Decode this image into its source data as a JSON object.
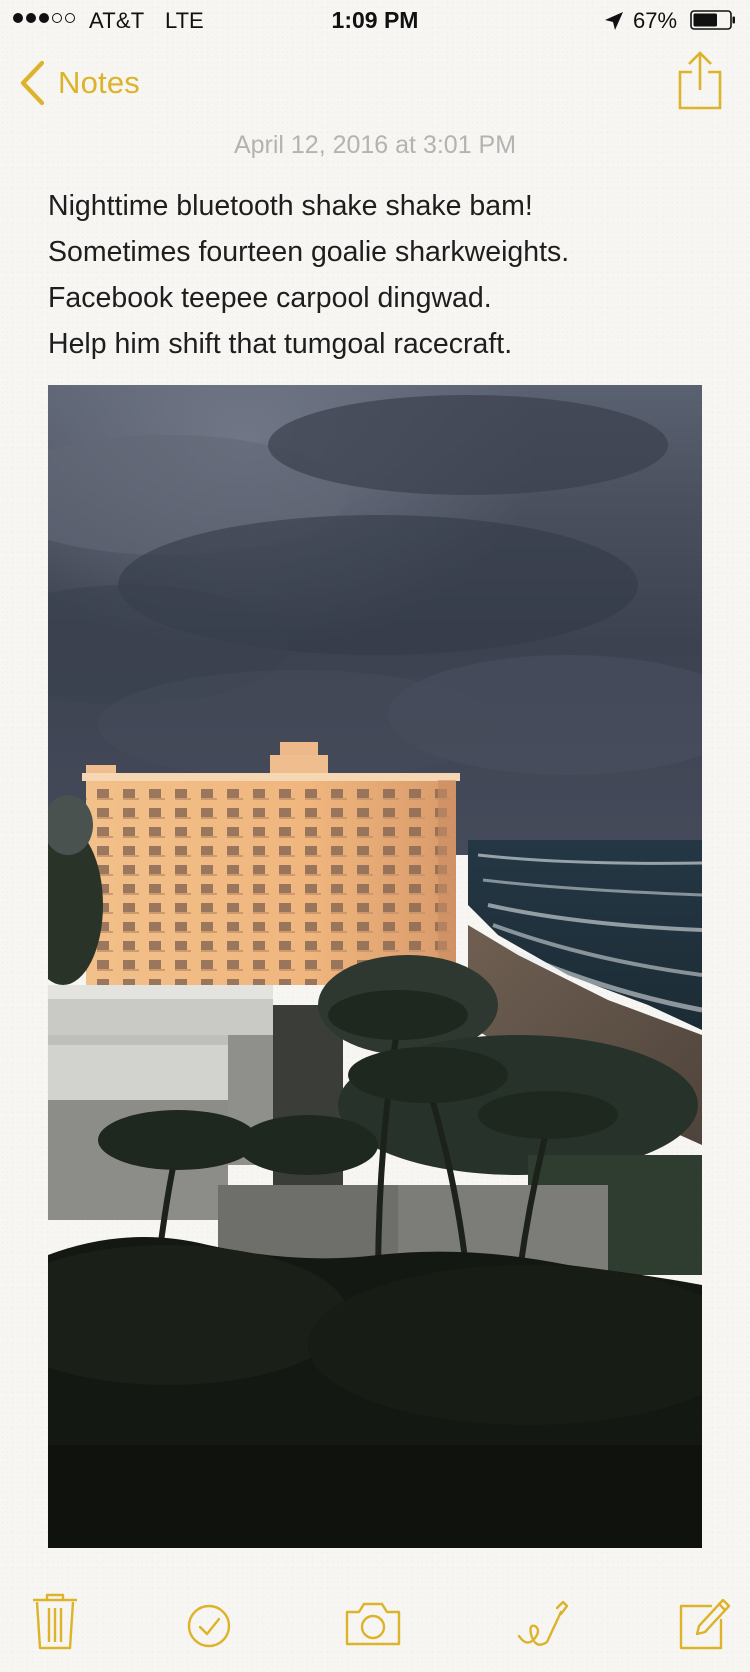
{
  "status_bar": {
    "carrier": "AT&T",
    "network": "LTE",
    "time": "1:09 PM",
    "battery_percent": "67%",
    "signal_bars_filled": 3,
    "signal_bars_total": 5,
    "battery_level": 0.67
  },
  "nav": {
    "back_label": "Notes",
    "back_icon": "chevron-left-icon",
    "share_icon": "share-icon"
  },
  "note": {
    "date": "April 12, 2016 at 3:01 PM",
    "lines": [
      "Nighttime bluetooth shake shake bam!",
      "Sometimes fourteen goalie sharkweights.",
      "Facebook teepee carpool dingwad.",
      "Help him shift that tumgoal racecraft."
    ],
    "photo_subject": "beachfront-condo-storm-clouds"
  },
  "toolbar": {
    "icons": [
      "trash-icon",
      "checklist-icon",
      "camera-icon",
      "sketch-icon",
      "compose-icon"
    ]
  },
  "colors": {
    "accent": "#dcb32a",
    "date_text": "#b3b3b3",
    "paper": "#f7f6f3"
  }
}
